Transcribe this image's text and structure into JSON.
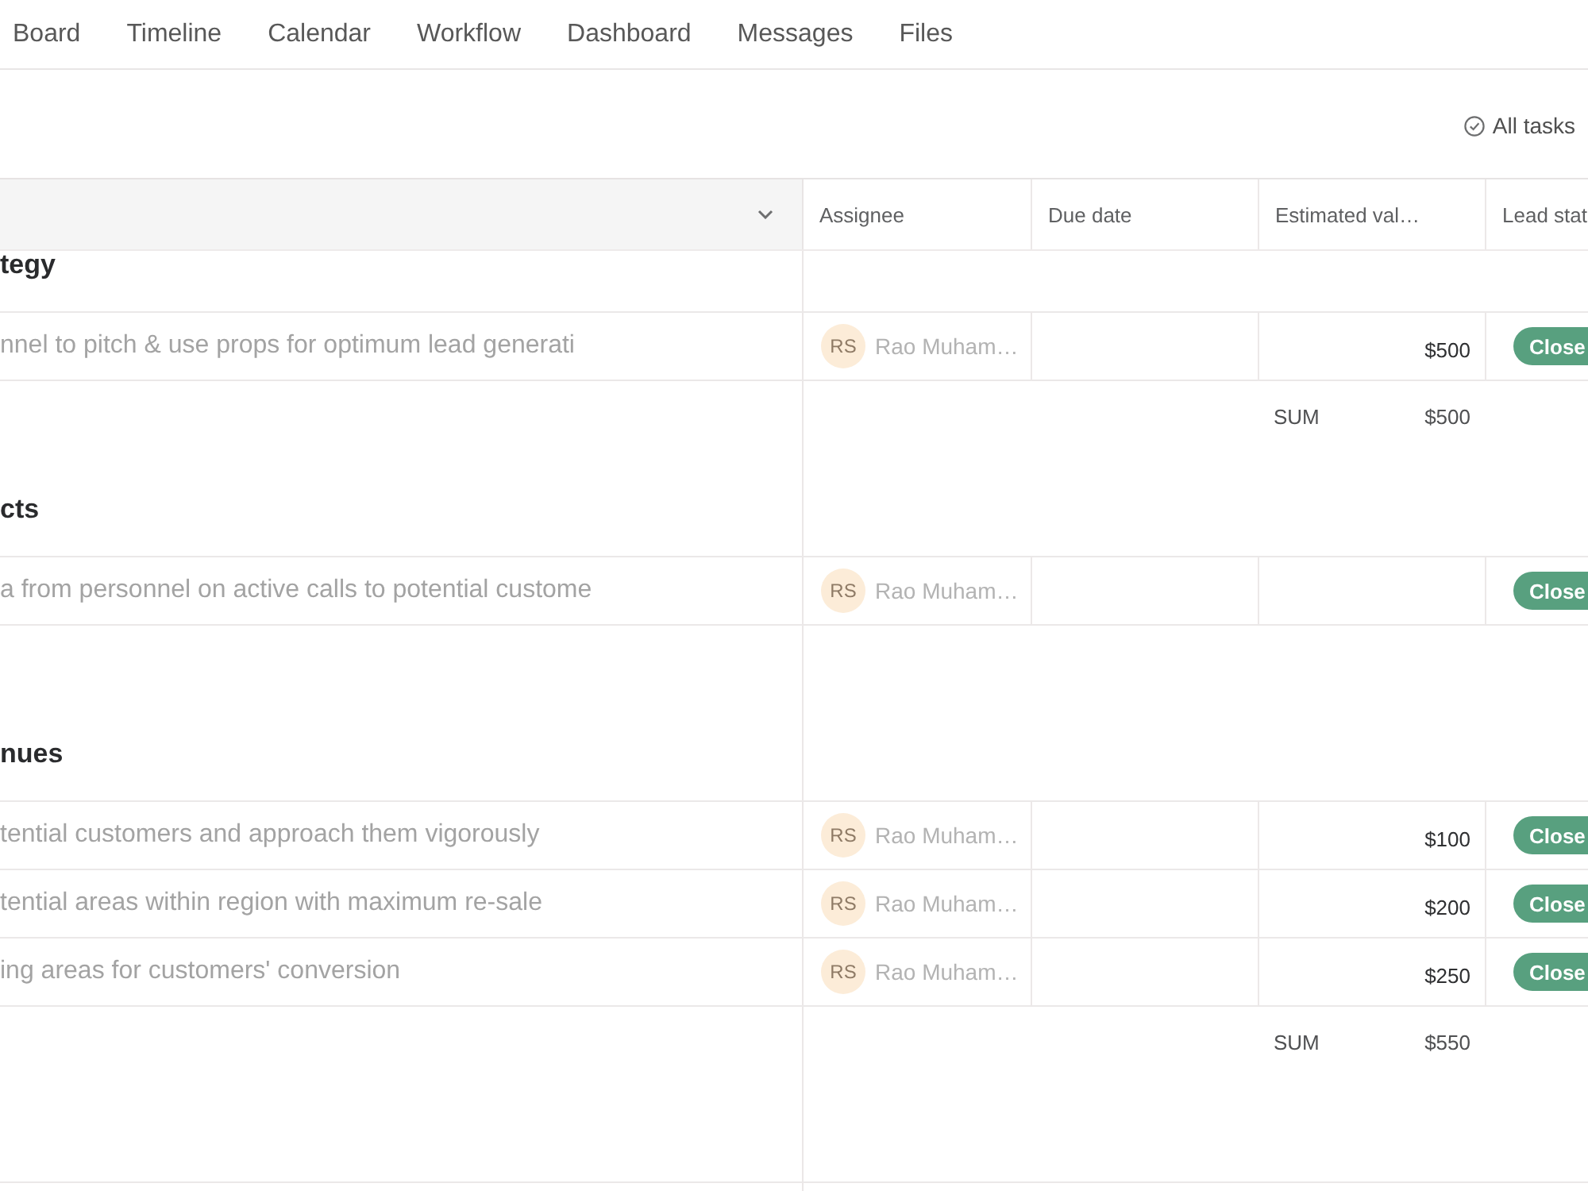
{
  "tabs": [
    {
      "label": "Board",
      "selected": false
    },
    {
      "label": "Timeline",
      "selected": false
    },
    {
      "label": "Calendar",
      "selected": false
    },
    {
      "label": "Workflow",
      "selected": false
    },
    {
      "label": "Dashboard",
      "selected": false
    },
    {
      "label": "Messages",
      "selected": false
    },
    {
      "label": "Files",
      "selected": false
    }
  ],
  "toolbar": {
    "filter": "All tasks"
  },
  "columns": [
    {
      "label": "Assignee"
    },
    {
      "label": "Due date"
    },
    {
      "label": "Estimated val…"
    },
    {
      "label": "Lead stat"
    }
  ],
  "sections": [
    {
      "title": "tegy",
      "tasks": [
        {
          "name": "nnel to pitch & use props for optimum lead generati",
          "completed": true,
          "assignee_initials": "RS",
          "assignee_name": "Rao Muham…",
          "estimated_value": "$500",
          "lead_status": "Close"
        }
      ],
      "sum": {
        "label": "SUM",
        "value": "$500"
      }
    },
    {
      "title": "cts",
      "tasks": [
        {
          "name": "a from personnel on active calls to potential custome",
          "completed": true,
          "assignee_initials": "RS",
          "assignee_name": "Rao Muham…",
          "lead_status": "Close"
        }
      ]
    },
    {
      "title": "nues",
      "tasks": [
        {
          "name": "tential customers and approach them vigorously",
          "completed": true,
          "assignee_initials": "RS",
          "assignee_name": "Rao Muham…",
          "estimated_value": "$100",
          "lead_status": "Close"
        },
        {
          "name": "tential areas within region with maximum re-sale",
          "completed": true,
          "assignee_initials": "RS",
          "assignee_name": "Rao Muham…",
          "estimated_value": "$200",
          "lead_status": "Close"
        },
        {
          "name": "ing areas for customers' conversion",
          "completed": true,
          "assignee_initials": "RS",
          "assignee_name": "Rao Muham…",
          "estimated_value": "$250",
          "lead_status": "Close"
        }
      ],
      "sum": {
        "label": "SUM",
        "value": "$550"
      }
    }
  ]
}
